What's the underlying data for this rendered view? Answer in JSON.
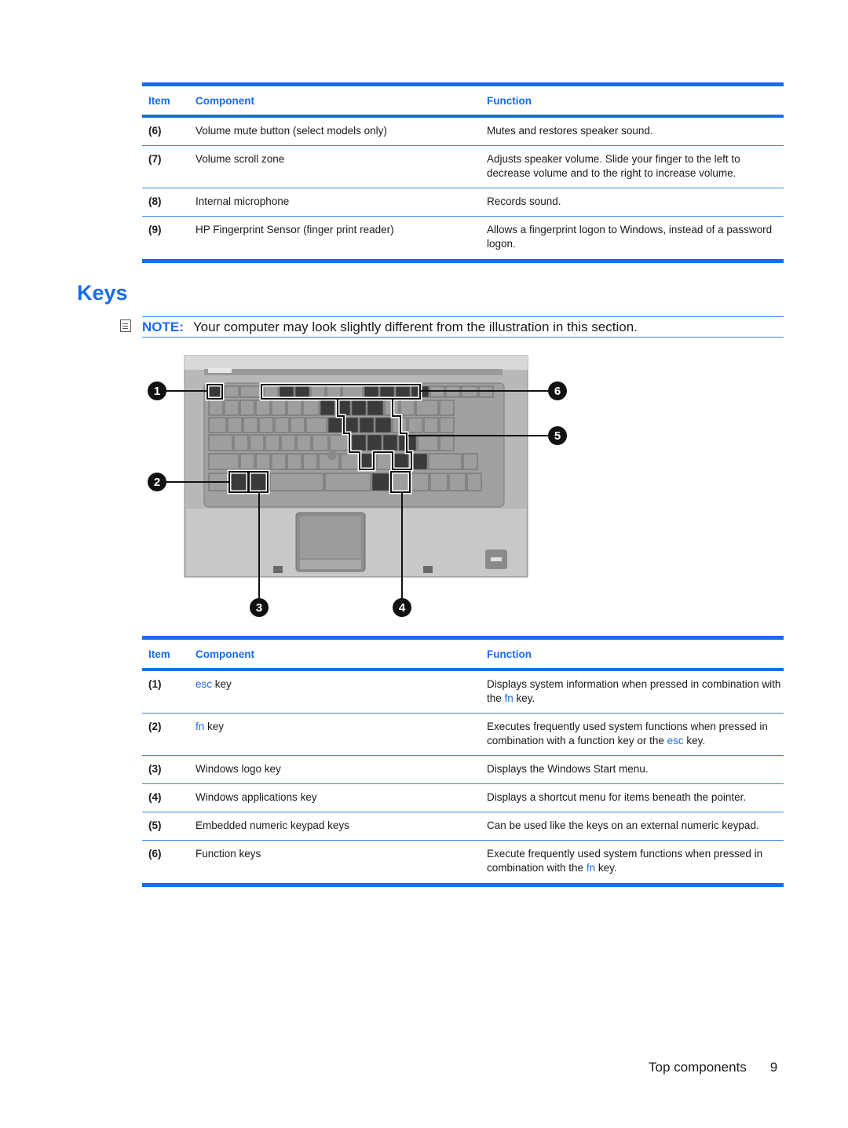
{
  "table_top": {
    "headers": {
      "item": "Item",
      "component": "Component",
      "function": "Function"
    },
    "rows": [
      {
        "item": "(6)",
        "component": "Volume mute button (select models only)",
        "function": "Mutes and restores speaker sound."
      },
      {
        "item": "(7)",
        "component": "Volume scroll zone",
        "function": "Adjusts speaker volume. Slide your finger to the left to decrease volume and to the right to increase volume."
      },
      {
        "item": "(8)",
        "component": "Internal microphone",
        "function": "Records sound."
      },
      {
        "item": "(9)",
        "component": "HP Fingerprint Sensor (finger print reader)",
        "function": "Allows a fingerprint logon to Windows, instead of a password logon."
      }
    ]
  },
  "section": {
    "heading": "Keys"
  },
  "note": {
    "icon": "note-icon",
    "label": "NOTE:",
    "text": "Your computer may look slightly different from the illustration in this section."
  },
  "figure": {
    "description": "Laptop keyboard illustration with callouts",
    "callouts": [
      "1",
      "2",
      "3",
      "4",
      "5",
      "6"
    ]
  },
  "table_keys": {
    "headers": {
      "item": "Item",
      "component": "Component",
      "function": "Function"
    },
    "rows": [
      {
        "item": "(1)",
        "component_kw": "esc",
        "component_rest": " key",
        "func_pre": "Displays system information when pressed in combination with the ",
        "func_kw": "fn",
        "func_post": " key."
      },
      {
        "item": "(2)",
        "component_kw": "fn",
        "component_rest": " key",
        "func_pre": "Executes frequently used system functions when pressed in combination with a function key or the ",
        "func_kw": "esc",
        "func_post": " key."
      },
      {
        "item": "(3)",
        "component": "Windows logo key",
        "function": "Displays the Windows Start menu."
      },
      {
        "item": "(4)",
        "component": "Windows applications key",
        "function": "Displays a shortcut menu for items beneath the pointer."
      },
      {
        "item": "(5)",
        "component": "Embedded numeric keypad keys",
        "function": "Can be used like the keys on an external numeric keypad."
      },
      {
        "item": "(6)",
        "component": "Function keys",
        "func_pre": "Execute frequently used system functions when pressed in combination with the ",
        "func_kw": "fn",
        "func_post": " key."
      }
    ]
  },
  "footer": {
    "section": "Top components",
    "page": "9"
  },
  "colors": {
    "accent": "#1a6ce8"
  }
}
